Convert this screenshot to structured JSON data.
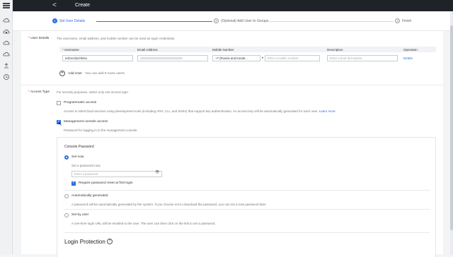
{
  "header": {
    "title": "Create",
    "back_glyph": "<"
  },
  "sidebar": {
    "icons": [
      "menu-icon",
      "cloud-icon",
      "lock-cloud-icon",
      "cloud-server-icon",
      "cloud-icon",
      "user-upload-icon",
      "history-icon"
    ]
  },
  "steps": [
    {
      "num": "1",
      "label": "Set User Details",
      "active": true
    },
    {
      "num": "2",
      "label": "(Optional) Add User to Groups",
      "active": false
    },
    {
      "num": "3",
      "label": "Finish",
      "active": false
    }
  ],
  "user_details": {
    "label": "User Details",
    "description": "The username, email address, and mobile number can be used as login credentials.",
    "columns": [
      "Username",
      "Email Address",
      "Mobile Number",
      "Description",
      "Operation"
    ],
    "row": {
      "username": "edzvezdochkina",
      "country_code": "+7 (Russia and Kazak...",
      "mobile_placeholder": "Enter a mobile number.",
      "description_placeholder": "Enter a brief description.",
      "operation": "Delete"
    },
    "add_user_label": "Add User",
    "add_user_hint": "You can add 9 more users."
  },
  "access_type": {
    "label": "Access Type",
    "description": "For security purposes, select only one access type.",
    "programmatic": {
      "title": "Programmatic access",
      "text": "Access to SberCloud services using development tools (including APIs, CLI, and SDKs) that support key authentication. An access key will be automatically generated for each user.",
      "link": "Learn more",
      "checked": false
    },
    "console": {
      "title": "Management console access",
      "text": "Password for logging in to the management console.",
      "checked": true
    }
  },
  "console_password": {
    "heading": "Console Password",
    "set_now": {
      "label": "Set now",
      "hint": "Set a password now.",
      "placeholder": "Enter a password.",
      "reset_label": "Require password reset at first login"
    },
    "auto": {
      "label": "Automatically generated",
      "hint": "A password will be automatically generated by the system. If you choose not to download the password, you can set a new password later."
    },
    "by_user": {
      "label": "Set by user",
      "hint": "A one-time login URL will be emailed to the user. The user can then click on the link to set a password."
    }
  },
  "login_protection": {
    "heading": "Login Protection",
    "help_glyph": "?"
  },
  "colors": {
    "primary": "#2b6ee0",
    "header": "#1f2229",
    "required": "#e0332b"
  }
}
